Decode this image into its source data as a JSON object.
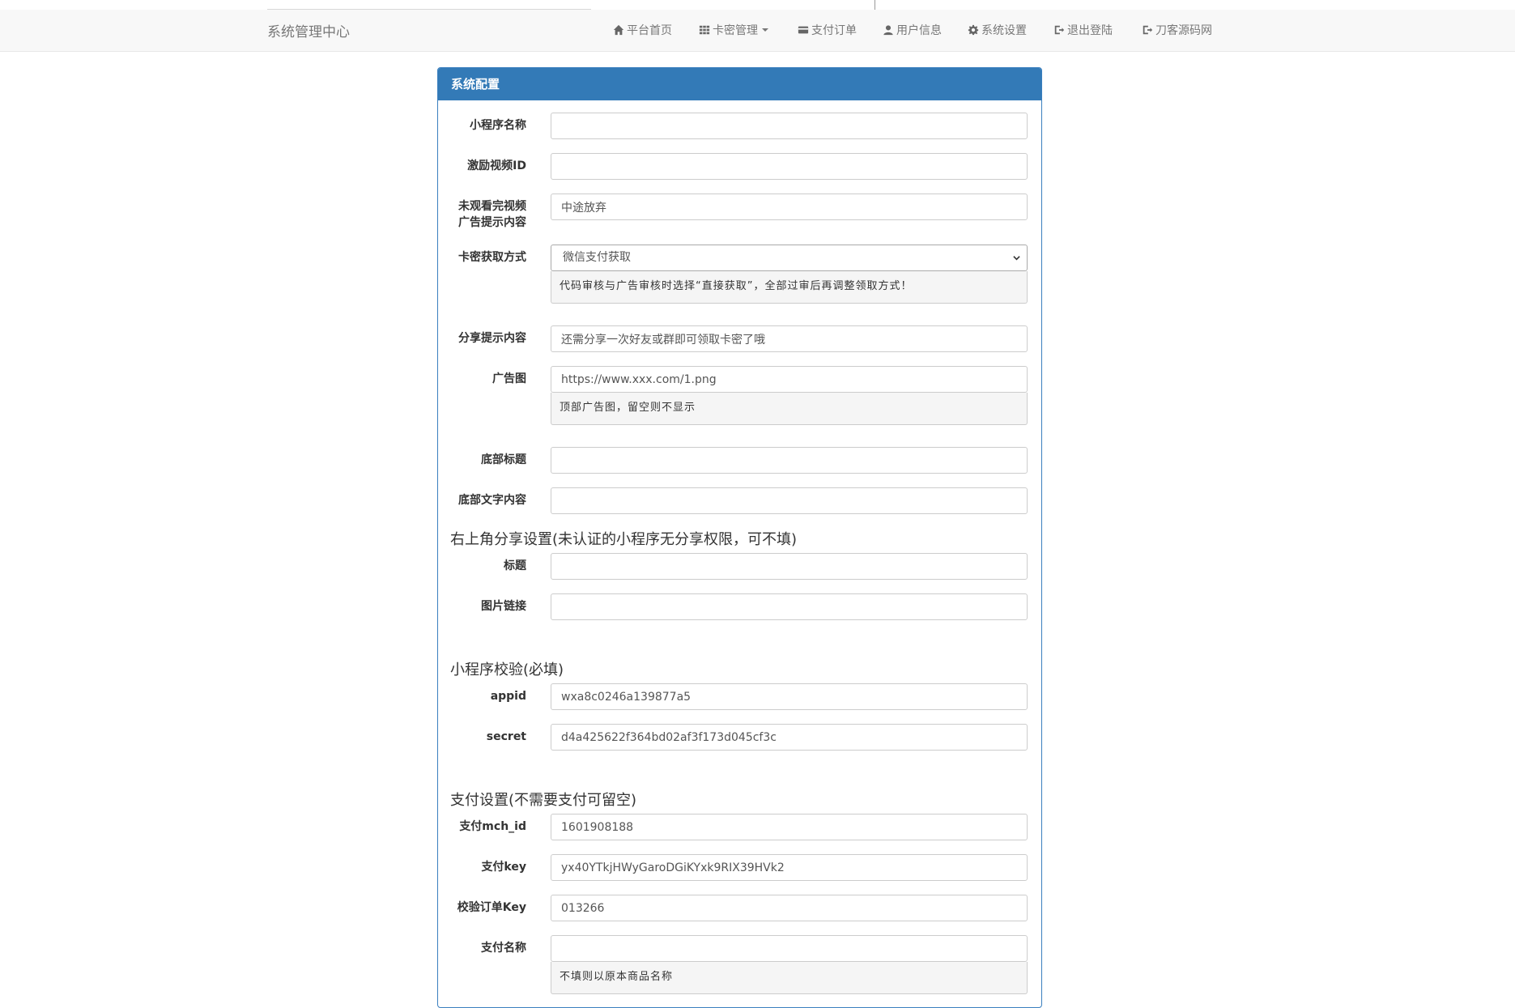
{
  "navbar": {
    "brand": "系统管理中心",
    "items": [
      {
        "label": "平台首页",
        "icon": "home-icon"
      },
      {
        "label": "卡密管理",
        "icon": "grid-icon"
      },
      {
        "label": "支付订单",
        "icon": "card-icon"
      },
      {
        "label": "用户信息",
        "icon": "user-icon"
      },
      {
        "label": "系统设置",
        "icon": "gear-icon"
      },
      {
        "label": "退出登陆",
        "icon": "logout-icon"
      },
      {
        "label": "刀客源码网",
        "icon": "logout-icon"
      }
    ]
  },
  "panel": {
    "title": "系统配置"
  },
  "form": {
    "app_name": {
      "label": "小程序名称",
      "value": ""
    },
    "video_id": {
      "label": "激励视频ID",
      "value": ""
    },
    "unfinished_tip": {
      "label_line1": "未观看完视频",
      "label_line2": "广告提示内容",
      "value": "中途放弃"
    },
    "card_method": {
      "label": "卡密获取方式",
      "value": "微信支付获取",
      "help": "代码审核与广告审核时选择“直接获取”，全部过审后再调整领取方式！"
    },
    "share_tip": {
      "label": "分享提示内容",
      "value": "还需分享一次好友或群即可领取卡密了哦"
    },
    "ad_image": {
      "label": "广告图",
      "value": "https://www.xxx.com/1.png",
      "help": "顶部广告图，留空则不显示"
    },
    "footer_title": {
      "label": "底部标题",
      "value": ""
    },
    "footer_text": {
      "label": "底部文字内容",
      "value": ""
    }
  },
  "share_section": {
    "title": "右上角分享设置(未认证的小程序无分享权限，可不填)",
    "share_title": {
      "label": "标题",
      "value": ""
    },
    "image_link": {
      "label": "图片链接",
      "value": ""
    }
  },
  "verify_section": {
    "title": "小程序校验(必填)",
    "appid": {
      "label": "appid",
      "value": "wxa8c0246a139877a5"
    },
    "secret": {
      "label": "secret",
      "value": "d4a425622f364bd02af3f173d045cf3c"
    }
  },
  "pay_section": {
    "title": "支付设置(不需要支付可留空)",
    "mch_id": {
      "label": "支付mch_id",
      "value": "1601908188"
    },
    "pay_key": {
      "label": "支付key",
      "value": "yx40YTkjHWyGaroDGiKYxk9RIX39HVk2"
    },
    "order_key": {
      "label": "校验订单Key",
      "value": "013266"
    },
    "pay_name": {
      "label": "支付名称",
      "value": "",
      "help": "不填则以原本商品名称"
    }
  },
  "colors": {
    "primary": "#337ab7",
    "navbar_bg": "#f8f8f8"
  }
}
